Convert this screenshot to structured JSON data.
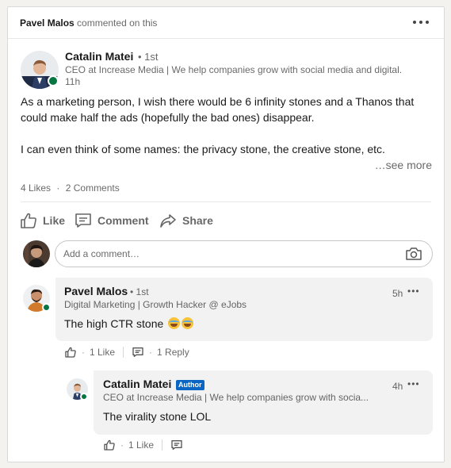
{
  "context": {
    "actor": "Pavel Malos",
    "action": "commented on this"
  },
  "post": {
    "author": {
      "name": "Catalin Matei",
      "degree": "• 1st",
      "headline": "CEO at Increase Media | We help companies grow with social media and digital.",
      "time": "11h"
    },
    "text_line1": "As a marketing person, I wish there would be 6 infinity stones and a Thanos that",
    "text_line2": "could make half the ads (hopefully the bad ones) disappear.",
    "text_line3": "I can even think of some names: the privacy stone, the creative stone, etc.",
    "see_more": "…see more",
    "likes": "4 Likes",
    "count_sep": "·",
    "comments": "2 Comments"
  },
  "actions": {
    "like": "Like",
    "comment": "Comment",
    "share": "Share"
  },
  "comment_box": {
    "placeholder": "Add a comment…"
  },
  "comments": [
    {
      "name": "Pavel Malos",
      "degree": "• 1st",
      "headline": "Digital Marketing | Growth Hacker @ eJobs",
      "time": "5h",
      "text": "The high CTR stone",
      "likes": "1 Like",
      "replies": "1 Reply",
      "sep": "·"
    },
    {
      "name": "Catalin Matei",
      "badge": "Author",
      "headline": "CEO at Increase Media | We help companies grow with socia...",
      "time": "4h",
      "text": "The virality stone LOL",
      "likes": "1 Like",
      "sep": "·"
    }
  ],
  "colors": {
    "presence": "#057642",
    "author_badge": "#0a66c2",
    "bubble": "#f2f2f2"
  }
}
